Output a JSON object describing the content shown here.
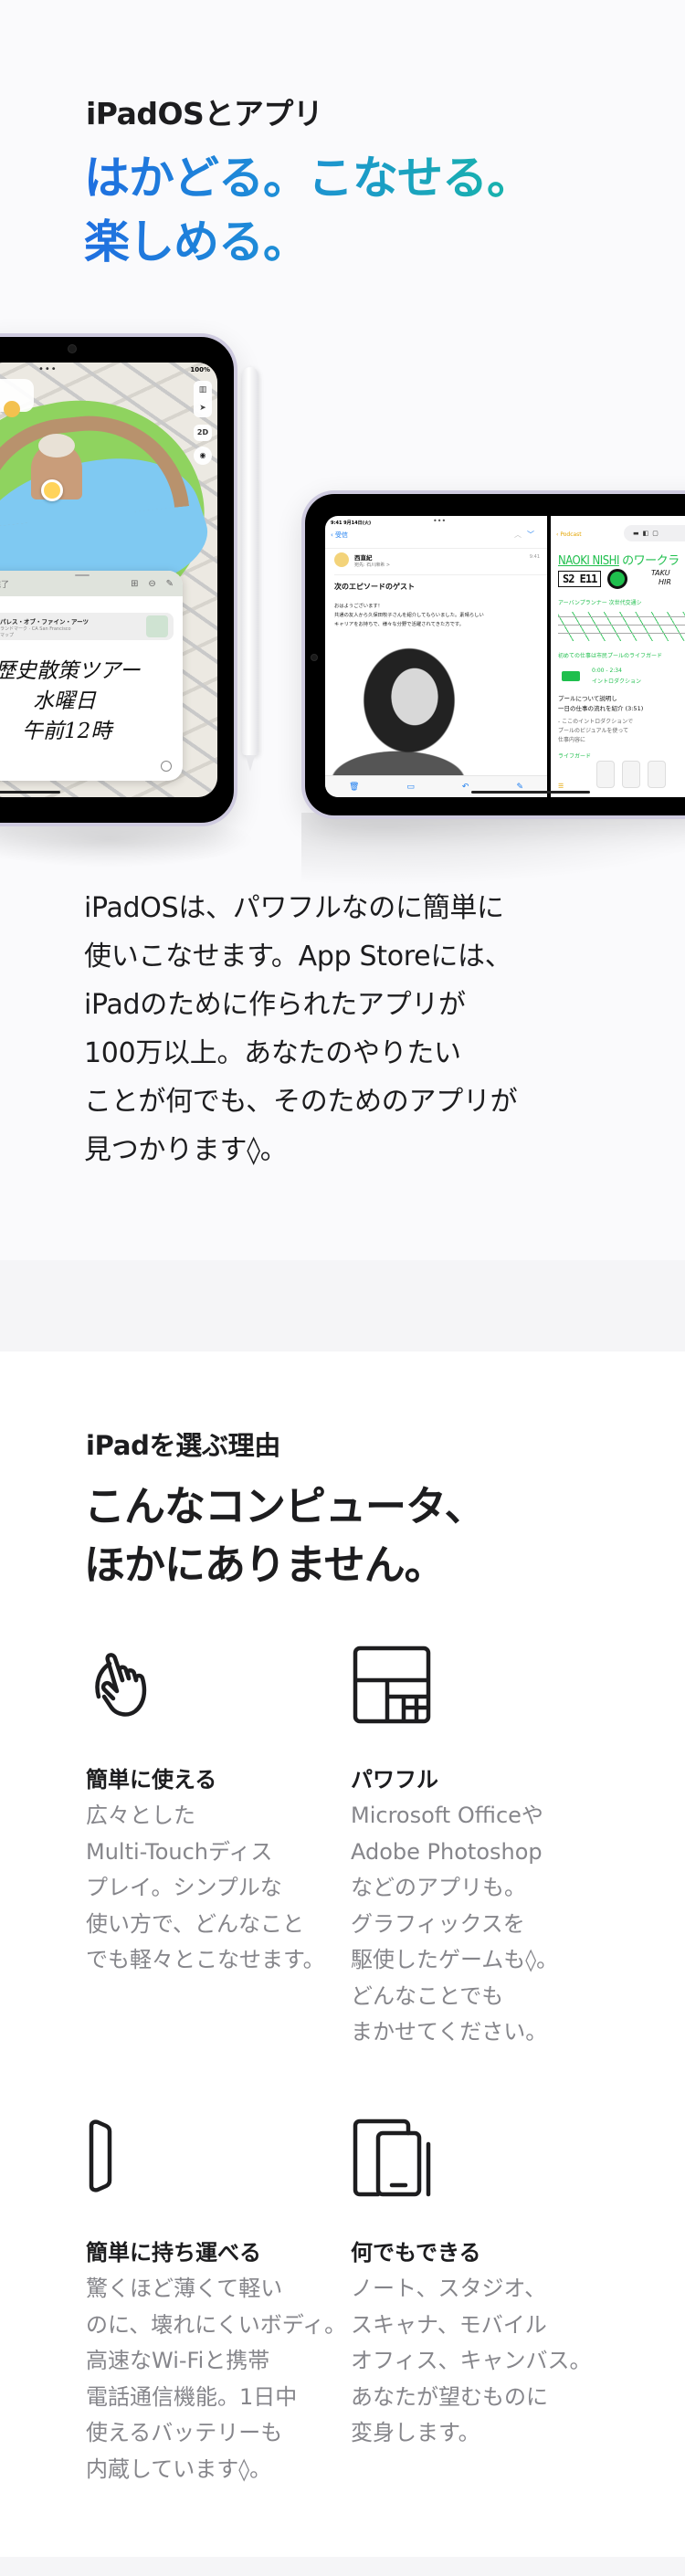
{
  "section_apps": {
    "eyebrow": "iPadOSとアプリ",
    "headline": "はかどる。こなせる。楽しめる。",
    "headline_lines": [
      "はかどる。こなせる。",
      "楽しめる。"
    ],
    "headline_gradient": [
      "#1f6fe0",
      "#17b6a8"
    ],
    "body_lines": [
      "iPadOSは、パワフルなのに簡単に",
      "使いこなせます。App Storeには、",
      "iPadのために作られたアプリが",
      "100万以上。あなたのやりたい",
      "ことが何でも、そのためのアプリが",
      "見つかります◊。"
    ],
    "hero": {
      "left_ipad": {
        "status": "100%",
        "map_controls": [
          "map-icon",
          "location-arrow-icon"
        ],
        "map_mode": "2D",
        "note": {
          "done_label": "完了",
          "link_title": "パレス・オブ・ファイン・アーツ",
          "link_subtitle": "ランドマーク · CA San Francisco",
          "link_source": "マップ",
          "handwriting_lines": [
            "歴史散策ツアー",
            "水曜日",
            "午前12時"
          ]
        }
      },
      "right_ipad": {
        "mail": {
          "status_time": "9:41  9月14日(火)",
          "back_label": "受信",
          "sender": "西直紀",
          "recipient": "宛先: 石川麻希 >",
          "time": "9:41",
          "subject": "次のエピソードのゲスト",
          "body_lines": [
            "おはようございます！",
            "共通の友人から久保田牧子さんを紹介してもらいました。素晴らしい",
            "キャリアをお持ちで、様々な分野で活躍されてきた方です。"
          ]
        },
        "notes": {
          "back_label": "Podcast",
          "title_name": "NAOKI NISHI",
          "title_rest": "のワークラ",
          "episode": "S2 E11",
          "guest_lines": [
            "TAKU",
            "HIR"
          ],
          "line1": "アーバンプランナー  次世代交通シ",
          "line2": "初めての仕事は市民プールのライフガード",
          "timecode": "0:00 - 2:34",
          "timecode_label": "イントロダクション",
          "note_lines": [
            "プールについて説明し",
            "一日の仕事の流れを紹介 (3:51)"
          ],
          "sub_lines": [
            "- ここのイントロダクションで",
            "プールのビジュアルを使って",
            "仕事内容に"
          ],
          "footer": "ライフガード"
        }
      }
    }
  },
  "section_why": {
    "eyebrow": "iPadを選ぶ理由",
    "headline_lines": [
      "こんなコンピュータ、",
      "ほかにありません。"
    ],
    "features": [
      {
        "icon": "hand-tap-icon",
        "title": "簡単に使える",
        "desc_lines": [
          "広々とした",
          "Multi-Touchディス",
          "プレイ。シンプルな",
          "使い方で、どんなこと",
          "でも軽々とこなせます。"
        ]
      },
      {
        "icon": "split-windows-icon",
        "title": "パワフル",
        "desc_lines": [
          "Microsoft Officeや",
          "Adobe Photoshop",
          "などのアプリも。",
          "グラフィックスを",
          "駆使したゲームも◊。",
          "どんなことでも",
          "まかせてください。"
        ]
      },
      {
        "icon": "thin-ipad-side-icon",
        "title": "簡単に持ち運べる",
        "desc_lines": [
          "驚くほど薄くて軽い",
          "のに、壊れにくいボディ。",
          "高速なWi-Fiと携帯",
          "電話通信機能。1日中",
          "使えるバッテリーも",
          "内蔵しています◊。"
        ]
      },
      {
        "icon": "ipad-and-pencil-icon",
        "title": "何でもできる",
        "desc_lines": [
          "ノート、スタジオ、",
          "スキャナ、モバイル",
          "オフィス、キャンバス。",
          "あなたが望むものに",
          "変身します。"
        ]
      }
    ]
  }
}
